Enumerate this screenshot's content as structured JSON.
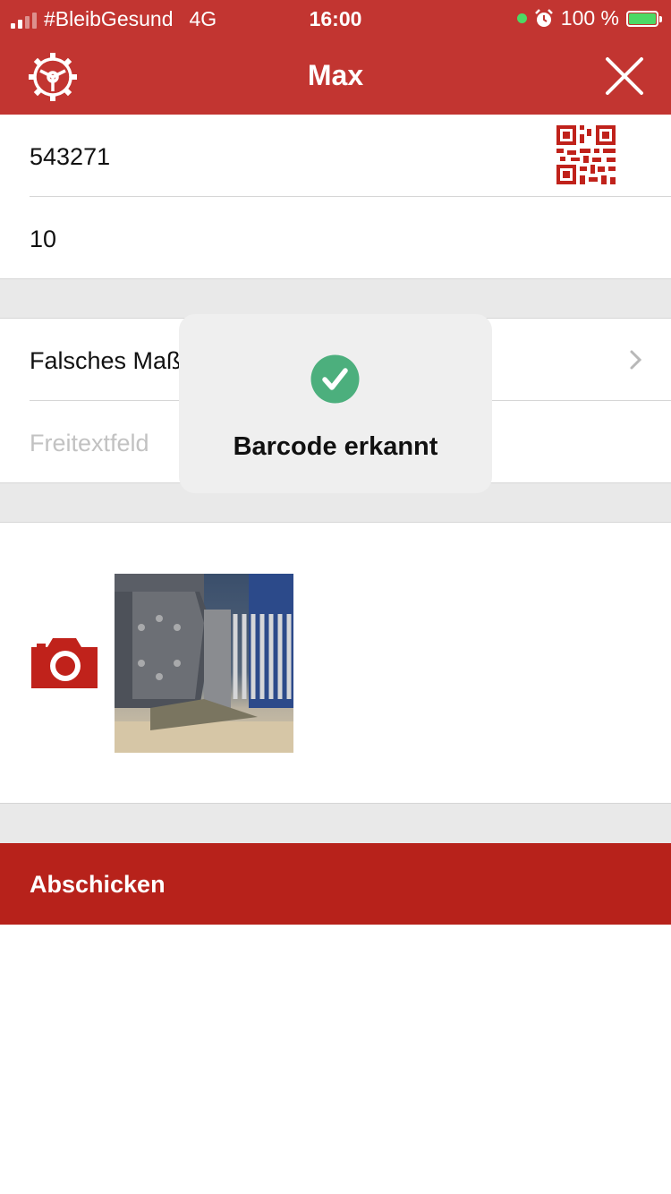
{
  "status_bar": {
    "carrier": "#BleibGesund",
    "network": "4G",
    "time": "16:00",
    "battery": "100 %"
  },
  "nav": {
    "title": "Max",
    "settings_icon": "gear-icon",
    "close_icon": "close-icon"
  },
  "form": {
    "barcode_value": "543271",
    "quantity_value": "10",
    "reason_value": "Falsches Maß",
    "freetext_placeholder": "Freitextfeld"
  },
  "photo": {
    "camera_icon": "camera-icon"
  },
  "submit_label": "Abschicken",
  "toast": {
    "message": "Barcode erkannt",
    "icon": "check-circle-icon"
  },
  "colors": {
    "brand_red": "#c23531",
    "submit_red": "#b7221b",
    "success_green": "#4caf7d"
  }
}
